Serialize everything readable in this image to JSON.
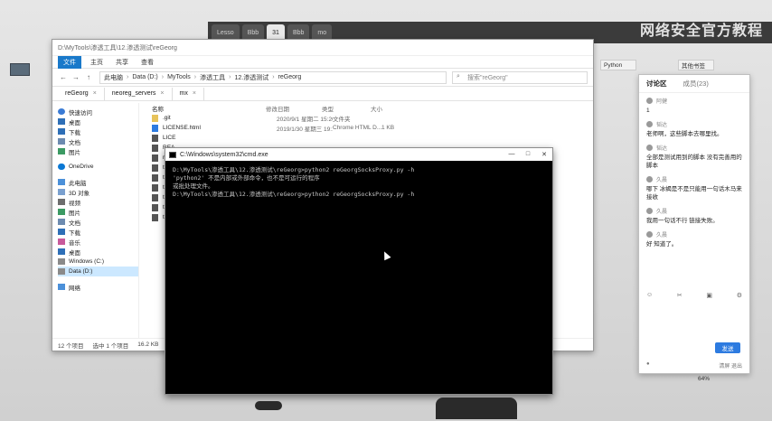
{
  "top_bar": {
    "tabs": [
      "Lesso",
      "Bbb",
      "31",
      "Bbb",
      "mo"
    ],
    "watermark": "网络安全官方教程"
  },
  "desktop": {
    "icon_label": ""
  },
  "explorer": {
    "title": "D:\\MyTools\\渗透工具\\12.渗透测试\\reGeorg",
    "ribbon": [
      "文件",
      "主页",
      "共享",
      "查看"
    ],
    "address": [
      "此电脑",
      "Data (D:)",
      "MyTools",
      "渗透工具",
      "12.渗透测试",
      "reGeorg"
    ],
    "search_placeholder": "搜索\"reGeorg\"",
    "tabs": [
      "reGeorg",
      "neoreg_servers",
      "mx"
    ],
    "nav": {
      "quick_access": "快速访问",
      "desktop": "桌面",
      "downloads": "下载",
      "documents": "文档",
      "pictures": "图片",
      "onedrive": "OneDrive",
      "this_pc": "此电脑",
      "objects3d": "3D 对象",
      "videos": "视频",
      "pictures2": "图片",
      "documents2": "文档",
      "downloads2": "下载",
      "music": "音乐",
      "desktop2": "桌面",
      "windows_c": "Windows (C:)",
      "data_d": "Data (D:)",
      "network": "网络"
    },
    "columns": [
      "名称",
      "修改日期",
      "类型",
      "大小"
    ],
    "files": [
      {
        "name": ".git",
        "date": "2020/9/1 星期二 15:20",
        "type": "文件夹",
        "size": ""
      },
      {
        "name": "LICENSE.html",
        "date": "2019/1/30 星期三 19:...",
        "type": "Chrome HTML D...",
        "size": "1 KB"
      },
      {
        "name": "LICE",
        "date": "",
        "type": "",
        "size": ""
      },
      {
        "name": "REA",
        "date": "",
        "type": "",
        "size": ""
      },
      {
        "name": "reGe",
        "date": "",
        "type": "",
        "size": ""
      },
      {
        "name": "tunn",
        "date": "",
        "type": "",
        "size": ""
      },
      {
        "name": "tunn",
        "date": "",
        "type": "",
        "size": ""
      },
      {
        "name": "tunn",
        "date": "",
        "type": "",
        "size": ""
      },
      {
        "name": "tunn",
        "date": "",
        "type": "",
        "size": ""
      },
      {
        "name": "tunn",
        "date": "",
        "type": "",
        "size": ""
      },
      {
        "name": "tunn",
        "date": "",
        "type": "",
        "size": ""
      }
    ],
    "status": [
      "12 个项目",
      "选中 1 个项目",
      "16.2 KB"
    ]
  },
  "cmd": {
    "title": "C:\\Windows\\system32\\cmd.exe",
    "lines": [
      "D:\\MyTools\\渗透工具\\12.渗透测试\\reGeorg>python2 reGeorgSocksProxy.py -h",
      "'python2' 不是内部或外部命令，也不是可运行的程序",
      "或批处理文件。",
      "",
      "D:\\MyTools\\渗透工具\\12.渗透测试\\reGeorg>python2 reGeorgSocksProxy.py -h"
    ]
  },
  "chat": {
    "tab_discuss": "讨论区",
    "tab_members": "成员(23)",
    "messages": [
      {
        "user": "阿健",
        "text": "1"
      },
      {
        "user": "韬达",
        "text": "老师啊，这些脚本去哪里找。"
      },
      {
        "user": "韬达",
        "text": "全部是测试用到的脚本 没有完善用的脚本"
      },
      {
        "user": "久晨",
        "text": "哪下 冰蝎是不是只能用一句话木马来接收"
      },
      {
        "user": "久晨",
        "text": "我用一句话不行 链接失败。"
      },
      {
        "user": "久晨",
        "text": "好 知道了。"
      }
    ],
    "send_label": "发送",
    "footer_left": "",
    "footer_right": "清屏 退出"
  },
  "side_tabs": {
    "python": "Python",
    "other": "其他书签"
  },
  "zoom_label": "64%"
}
